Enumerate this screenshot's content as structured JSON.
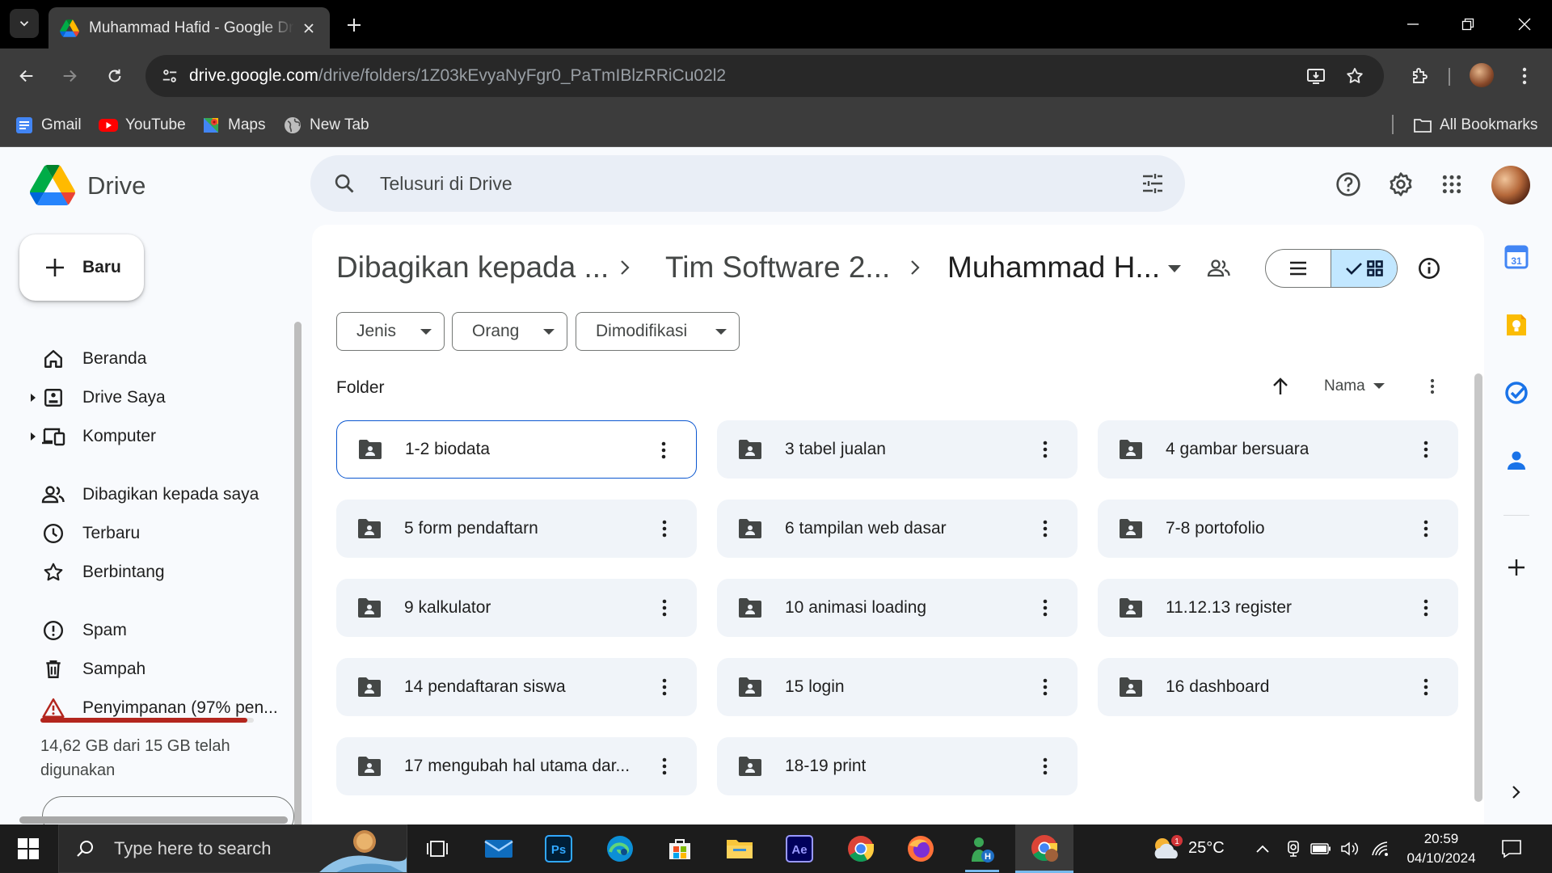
{
  "browser": {
    "tab_title": "Muhammad Hafid - Google Drive",
    "url_host": "drive.google.com",
    "url_path": "/drive/folders/1Z03kEvyaNyFgr0_PaTmIBlzRRiCu02l2",
    "bookmarks": [
      {
        "label": "Gmail",
        "icon": "gmail-icon"
      },
      {
        "label": "YouTube",
        "icon": "youtube-icon"
      },
      {
        "label": "Maps",
        "icon": "maps-icon"
      },
      {
        "label": "New Tab",
        "icon": "globe-icon"
      }
    ],
    "all_bookmarks": "All Bookmarks"
  },
  "drive": {
    "app_name": "Drive",
    "search_placeholder": "Telusuri di Drive",
    "new_button": "Baru",
    "nav": [
      {
        "label": "Beranda",
        "icon": "home-icon"
      },
      {
        "label": "Drive Saya",
        "icon": "my-drive-icon"
      },
      {
        "label": "Komputer",
        "icon": "computer-icon"
      },
      {
        "label": "Dibagikan kepada saya",
        "icon": "shared-icon"
      },
      {
        "label": "Terbaru",
        "icon": "clock-icon"
      },
      {
        "label": "Berbintang",
        "icon": "star-icon"
      },
      {
        "label": "Spam",
        "icon": "spam-icon"
      },
      {
        "label": "Sampah",
        "icon": "trash-icon"
      },
      {
        "label": "Penyimpanan (97% pen...",
        "icon": "storage-warning-icon"
      }
    ],
    "storage": {
      "used_fraction": 0.97,
      "text": "14,62 GB dari 15 GB telah digunakan",
      "bar_color": "#b3261e"
    },
    "breadcrumb": [
      "Dibagikan kepada ...",
      "Tim Software 2...",
      "Muhammad H..."
    ],
    "filters": [
      "Jenis",
      "Orang",
      "Dimodifikasi"
    ],
    "section_heading": "Folder",
    "sort_label": "Nama",
    "folders": [
      "1-2 biodata",
      "3 tabel jualan",
      "4 gambar bersuara",
      "5 form pendaftarn",
      "6 tampilan web dasar",
      "7-8 portofolio",
      "9 kalkulator",
      "10 animasi loading",
      "11.12.13 register",
      "14 pendaftaran siswa",
      "15 login",
      "16 dashboard",
      "17 mengubah hal utama dar...",
      "18-19 print"
    ],
    "selected_folder": "1-2 biodata",
    "colors": {
      "accent": "#0b57d0",
      "grid_toggle": "#c2e7ff"
    }
  },
  "taskbar": {
    "search_placeholder": "Type here to search",
    "temperature": "25°C",
    "time": "20:59",
    "date": "04/10/2024",
    "weather_badge": "1"
  }
}
